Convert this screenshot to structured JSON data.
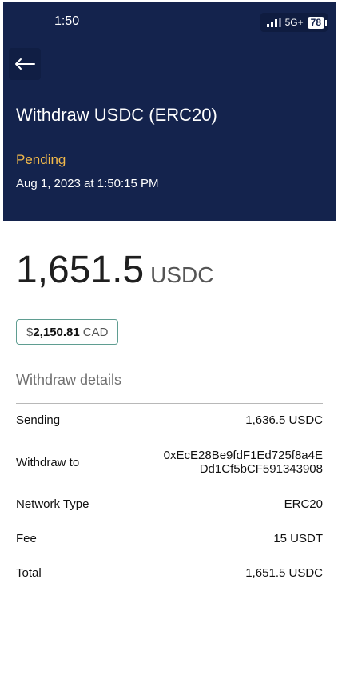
{
  "status_bar": {
    "time": "1:50",
    "network": "5G+",
    "battery": "78"
  },
  "header": {
    "back_icon": "back-arrow-icon",
    "title": "Withdraw USDC (ERC20)",
    "status": "Pending",
    "date": "Aug 1, 2023 at 1:50:15 PM"
  },
  "amount": {
    "value": "1,651.5",
    "unit": "USDC"
  },
  "fiat": {
    "symbol": "$",
    "value": "2,150.81",
    "currency": "CAD"
  },
  "details": {
    "section_title": "Withdraw details",
    "rows": [
      {
        "label": "Sending",
        "value": "1,636.5 USDC"
      },
      {
        "label": "Withdraw to",
        "value_line1": "0xEcE28Be9fdF1Ed725f8a4E",
        "value_line2": "Dd1Cf5bCF591343908"
      },
      {
        "label": "Network Type",
        "value": "ERC20"
      },
      {
        "label": "Fee",
        "value": "15 USDT"
      },
      {
        "label": "Total",
        "value": "1,651.5 USDC"
      }
    ]
  },
  "colors": {
    "header_bg": "#14234d",
    "pending": "#f2b94a",
    "chip_border": "#5f9d91"
  }
}
